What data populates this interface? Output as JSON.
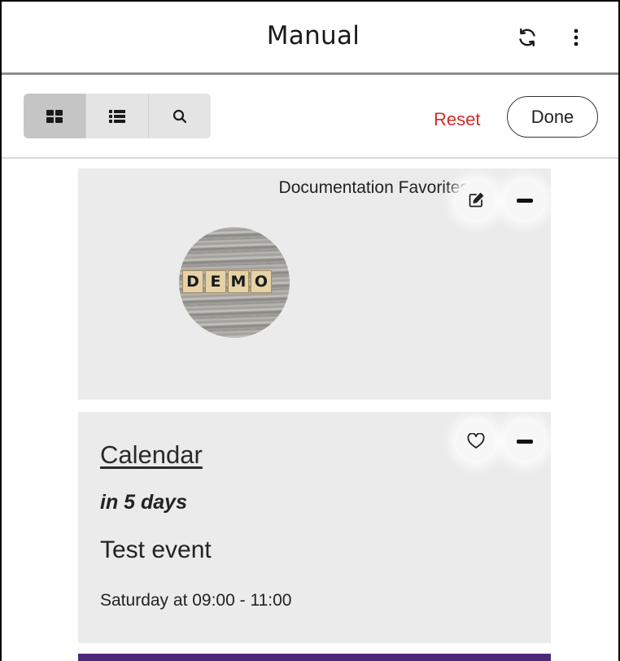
{
  "header": {
    "title": "Manual",
    "refresh_icon": "refresh-icon",
    "menu_icon": "more-vertical-icon"
  },
  "toolbar": {
    "view_modes": [
      {
        "icon": "grid-view-icon",
        "active": true
      },
      {
        "icon": "list-view-icon",
        "active": false
      },
      {
        "icon": "search-icon",
        "active": false
      }
    ],
    "reset_label": "Reset",
    "done_label": "Done",
    "colors": {
      "reset": "#d42a2a"
    }
  },
  "widgets": [
    {
      "title": "Documentation Favorites",
      "actions": [
        "edit-icon",
        "remove-icon"
      ],
      "items": [
        {
          "image_icon": "demo-thumbnail",
          "tiles": [
            "D",
            "E",
            "M",
            "O"
          ]
        }
      ]
    },
    {
      "link_label": "Calendar",
      "relative_when": "in 5 days",
      "event_title": "Test event",
      "event_time": "Saturday at 09:00 - 11:00",
      "actions": [
        "heart-icon",
        "remove-icon"
      ]
    }
  ],
  "colors": {
    "card_bg": "#ebebeb",
    "accent_next_card": "#4b2a78"
  }
}
